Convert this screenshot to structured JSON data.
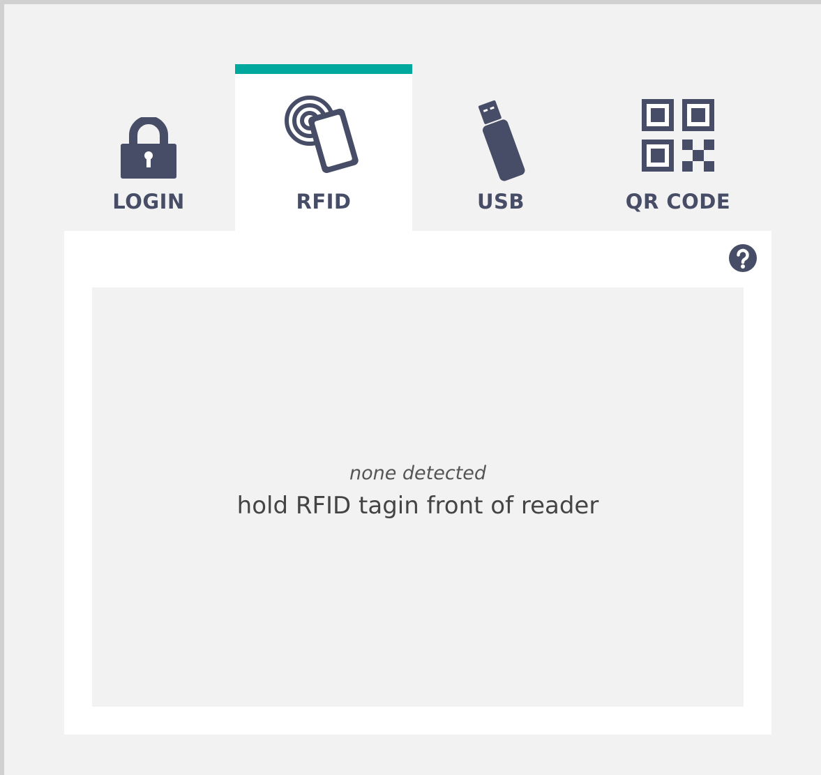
{
  "colors": {
    "accent": "#00a89d",
    "icon": "#474d66",
    "panel_bg": "#ffffff",
    "page_bg": "#f2f2f2",
    "outer_border": "#d0d0d0"
  },
  "tabs": [
    {
      "label": "LOGIN",
      "icon": "padlock-icon",
      "active": false
    },
    {
      "label": "RFID",
      "icon": "rfid-card-icon",
      "active": true
    },
    {
      "label": "USB",
      "icon": "usb-stick-icon",
      "active": false
    },
    {
      "label": "QR CODE",
      "icon": "qr-code-icon",
      "active": false
    }
  ],
  "help": {
    "icon": "question-circle-icon"
  },
  "reader": {
    "status": "none detected",
    "instruction": "hold RFID tagin front of reader"
  }
}
